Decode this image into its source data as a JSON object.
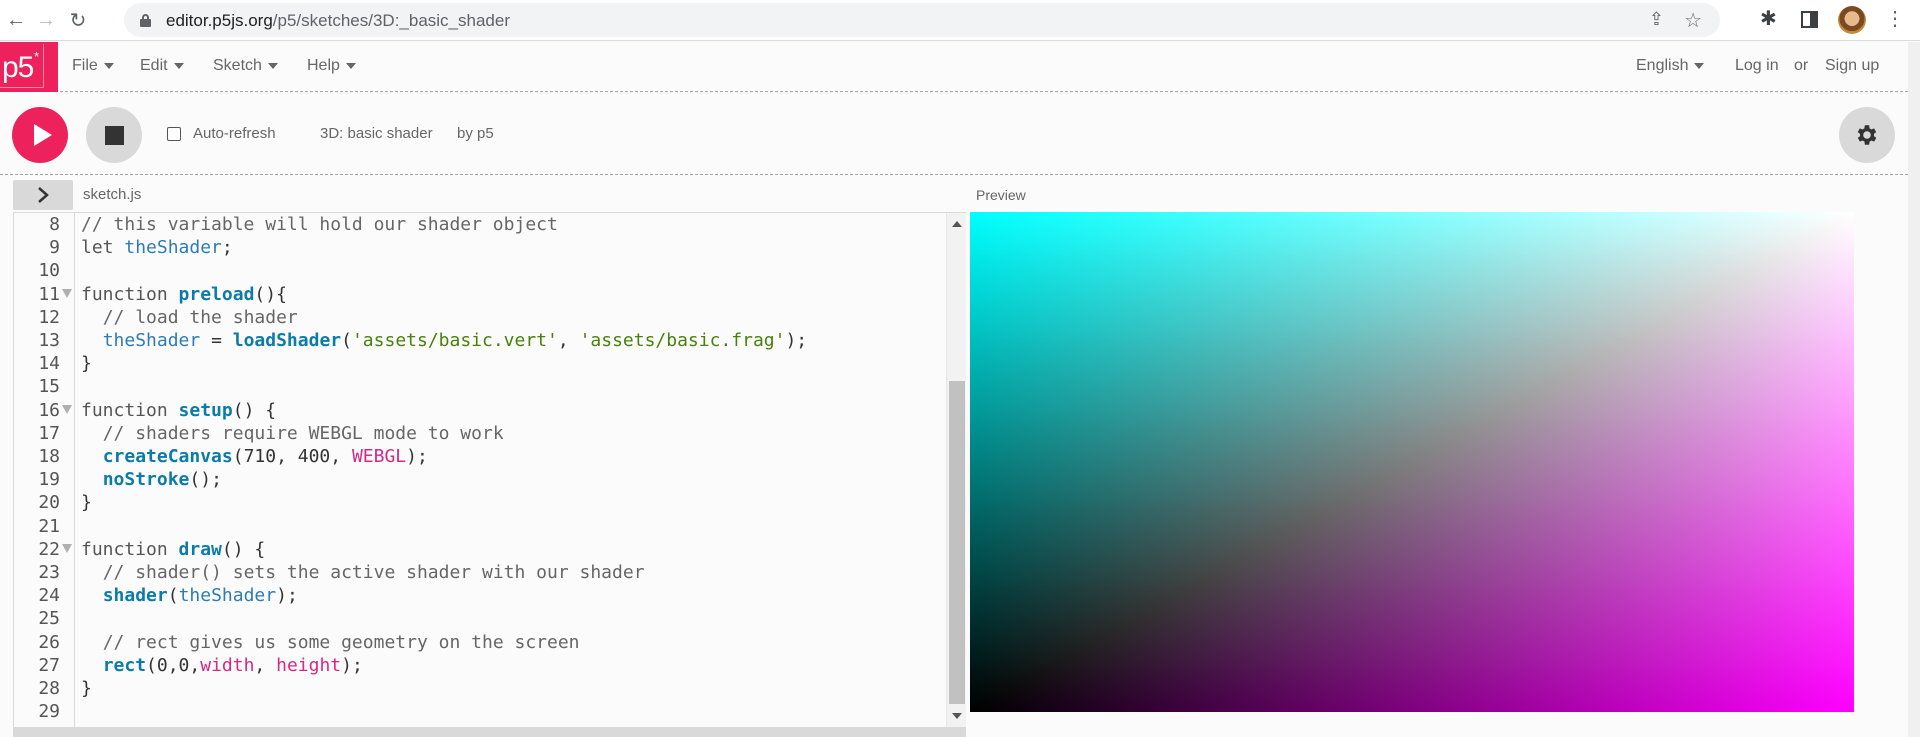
{
  "browser": {
    "url_domain": "editor.p5js.org",
    "url_path": "/p5/sketches/3D:_basic_shader",
    "icons": {
      "back": "←",
      "forward": "→",
      "reload": "↻",
      "share": "⇪",
      "star": "☆",
      "extensions": "✱",
      "menu": "⋮"
    }
  },
  "nav": {
    "logo": "p5",
    "logo_mark": "*",
    "menus": [
      "File",
      "Edit",
      "Sketch",
      "Help"
    ],
    "language": "English",
    "login": "Log in",
    "or": "or",
    "signup": "Sign up"
  },
  "toolbar": {
    "auto_refresh_label": "Auto-refresh",
    "auto_refresh_checked": false,
    "sketch_name": "3D: basic shader",
    "owner": "by p5"
  },
  "editor": {
    "filename": "sketch.js",
    "preview_label": "Preview",
    "lines": [
      {
        "n": "8",
        "fold": false,
        "tokens": [
          [
            "comment",
            "// this variable will hold our shader object"
          ]
        ]
      },
      {
        "n": "9",
        "fold": false,
        "tokens": [
          [
            "kw",
            "let "
          ],
          [
            "var",
            "theShader"
          ],
          [
            "plain",
            ";"
          ]
        ]
      },
      {
        "n": "10",
        "fold": false,
        "tokens": []
      },
      {
        "n": "11",
        "fold": true,
        "tokens": [
          [
            "kw",
            "function "
          ],
          [
            "fn",
            "preload"
          ],
          [
            "plain",
            "(){"
          ]
        ]
      },
      {
        "n": "12",
        "fold": false,
        "tokens": [
          [
            "plain",
            "  "
          ],
          [
            "comment",
            "// load the shader"
          ]
        ]
      },
      {
        "n": "13",
        "fold": false,
        "tokens": [
          [
            "plain",
            "  "
          ],
          [
            "var",
            "theShader"
          ],
          [
            "plain",
            " = "
          ],
          [
            "fn",
            "loadShader"
          ],
          [
            "plain",
            "("
          ],
          [
            "str",
            "'assets/basic.vert'"
          ],
          [
            "plain",
            ", "
          ],
          [
            "str",
            "'assets/basic.frag'"
          ],
          [
            "plain",
            ");"
          ]
        ]
      },
      {
        "n": "14",
        "fold": false,
        "tokens": [
          [
            "plain",
            "}"
          ]
        ]
      },
      {
        "n": "15",
        "fold": false,
        "tokens": []
      },
      {
        "n": "16",
        "fold": true,
        "tokens": [
          [
            "kw",
            "function "
          ],
          [
            "fn",
            "setup"
          ],
          [
            "plain",
            "() {"
          ]
        ]
      },
      {
        "n": "17",
        "fold": false,
        "tokens": [
          [
            "plain",
            "  "
          ],
          [
            "comment",
            "// shaders require WEBGL mode to work"
          ]
        ]
      },
      {
        "n": "18",
        "fold": false,
        "tokens": [
          [
            "plain",
            "  "
          ],
          [
            "fn",
            "createCanvas"
          ],
          [
            "plain",
            "(710, 400, "
          ],
          [
            "const",
            "WEBGL"
          ],
          [
            "plain",
            ");"
          ]
        ]
      },
      {
        "n": "19",
        "fold": false,
        "tokens": [
          [
            "plain",
            "  "
          ],
          [
            "fn",
            "noStroke"
          ],
          [
            "plain",
            "();"
          ]
        ]
      },
      {
        "n": "20",
        "fold": false,
        "tokens": [
          [
            "plain",
            "}"
          ]
        ]
      },
      {
        "n": "21",
        "fold": false,
        "tokens": []
      },
      {
        "n": "22",
        "fold": true,
        "tokens": [
          [
            "kw",
            "function "
          ],
          [
            "fn",
            "draw"
          ],
          [
            "plain",
            "() {"
          ]
        ]
      },
      {
        "n": "23",
        "fold": false,
        "tokens": [
          [
            "plain",
            "  "
          ],
          [
            "comment",
            "// shader() sets the active shader with our shader"
          ]
        ]
      },
      {
        "n": "24",
        "fold": false,
        "tokens": [
          [
            "plain",
            "  "
          ],
          [
            "fn",
            "shader"
          ],
          [
            "plain",
            "("
          ],
          [
            "var",
            "theShader"
          ],
          [
            "plain",
            ");"
          ]
        ]
      },
      {
        "n": "25",
        "fold": false,
        "tokens": []
      },
      {
        "n": "26",
        "fold": false,
        "tokens": [
          [
            "plain",
            "  "
          ],
          [
            "comment",
            "// rect gives us some geometry on the screen"
          ]
        ]
      },
      {
        "n": "27",
        "fold": false,
        "tokens": [
          [
            "plain",
            "  "
          ],
          [
            "fn",
            "rect"
          ],
          [
            "plain",
            "(0,0,"
          ],
          [
            "const",
            "width"
          ],
          [
            "plain",
            ", "
          ],
          [
            "const",
            "height"
          ],
          [
            "plain",
            ");"
          ]
        ]
      },
      {
        "n": "28",
        "fold": false,
        "tokens": [
          [
            "plain",
            "}"
          ]
        ]
      },
      {
        "n": "29",
        "fold": false,
        "tokens": []
      }
    ]
  },
  "colors": {
    "brand": "#ed225d",
    "gray_button": "#d9d9d9"
  }
}
